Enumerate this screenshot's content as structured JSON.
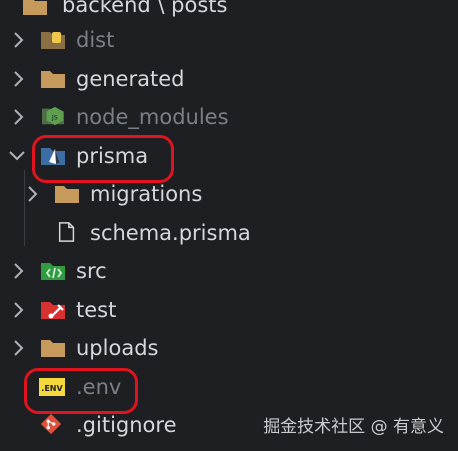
{
  "explorer": {
    "header": "backend \\ posts",
    "items": [
      {
        "label": "dist",
        "icon": "dist-folder-icon",
        "dim": true,
        "expanded": false
      },
      {
        "label": "generated",
        "icon": "folder-icon",
        "dim": false,
        "expanded": false
      },
      {
        "label": "node_modules",
        "icon": "node-folder-icon",
        "dim": true,
        "expanded": false
      },
      {
        "label": "prisma",
        "icon": "prisma-folder-icon",
        "dim": false,
        "expanded": true
      },
      {
        "label": "migrations",
        "icon": "folder-icon",
        "dim": false,
        "expanded": false
      },
      {
        "label": "schema.prisma",
        "icon": "file-icon",
        "dim": false
      },
      {
        "label": "src",
        "icon": "src-folder-icon",
        "dim": false,
        "expanded": false
      },
      {
        "label": "test",
        "icon": "test-folder-icon",
        "dim": false,
        "expanded": false
      },
      {
        "label": "uploads",
        "icon": "folder-icon",
        "dim": false,
        "expanded": false
      },
      {
        "label": ".env",
        "icon": "env-file-icon",
        "dim": true
      },
      {
        "label": ".gitignore",
        "icon": "git-file-icon",
        "dim": false
      }
    ]
  },
  "icon_text": {
    "env": ".ENV",
    "js": "JS"
  },
  "watermark": "掘金技术社区 @ 有意义",
  "colors": {
    "background": "#1e1f22",
    "folder": "#c59a5a",
    "highlight": "#e0141e",
    "node_green": "#5fa04e",
    "src_green": "#2e9c3f",
    "test_red": "#d93030",
    "env_yellow": "#f4d83c",
    "git_orange": "#e0513a"
  }
}
